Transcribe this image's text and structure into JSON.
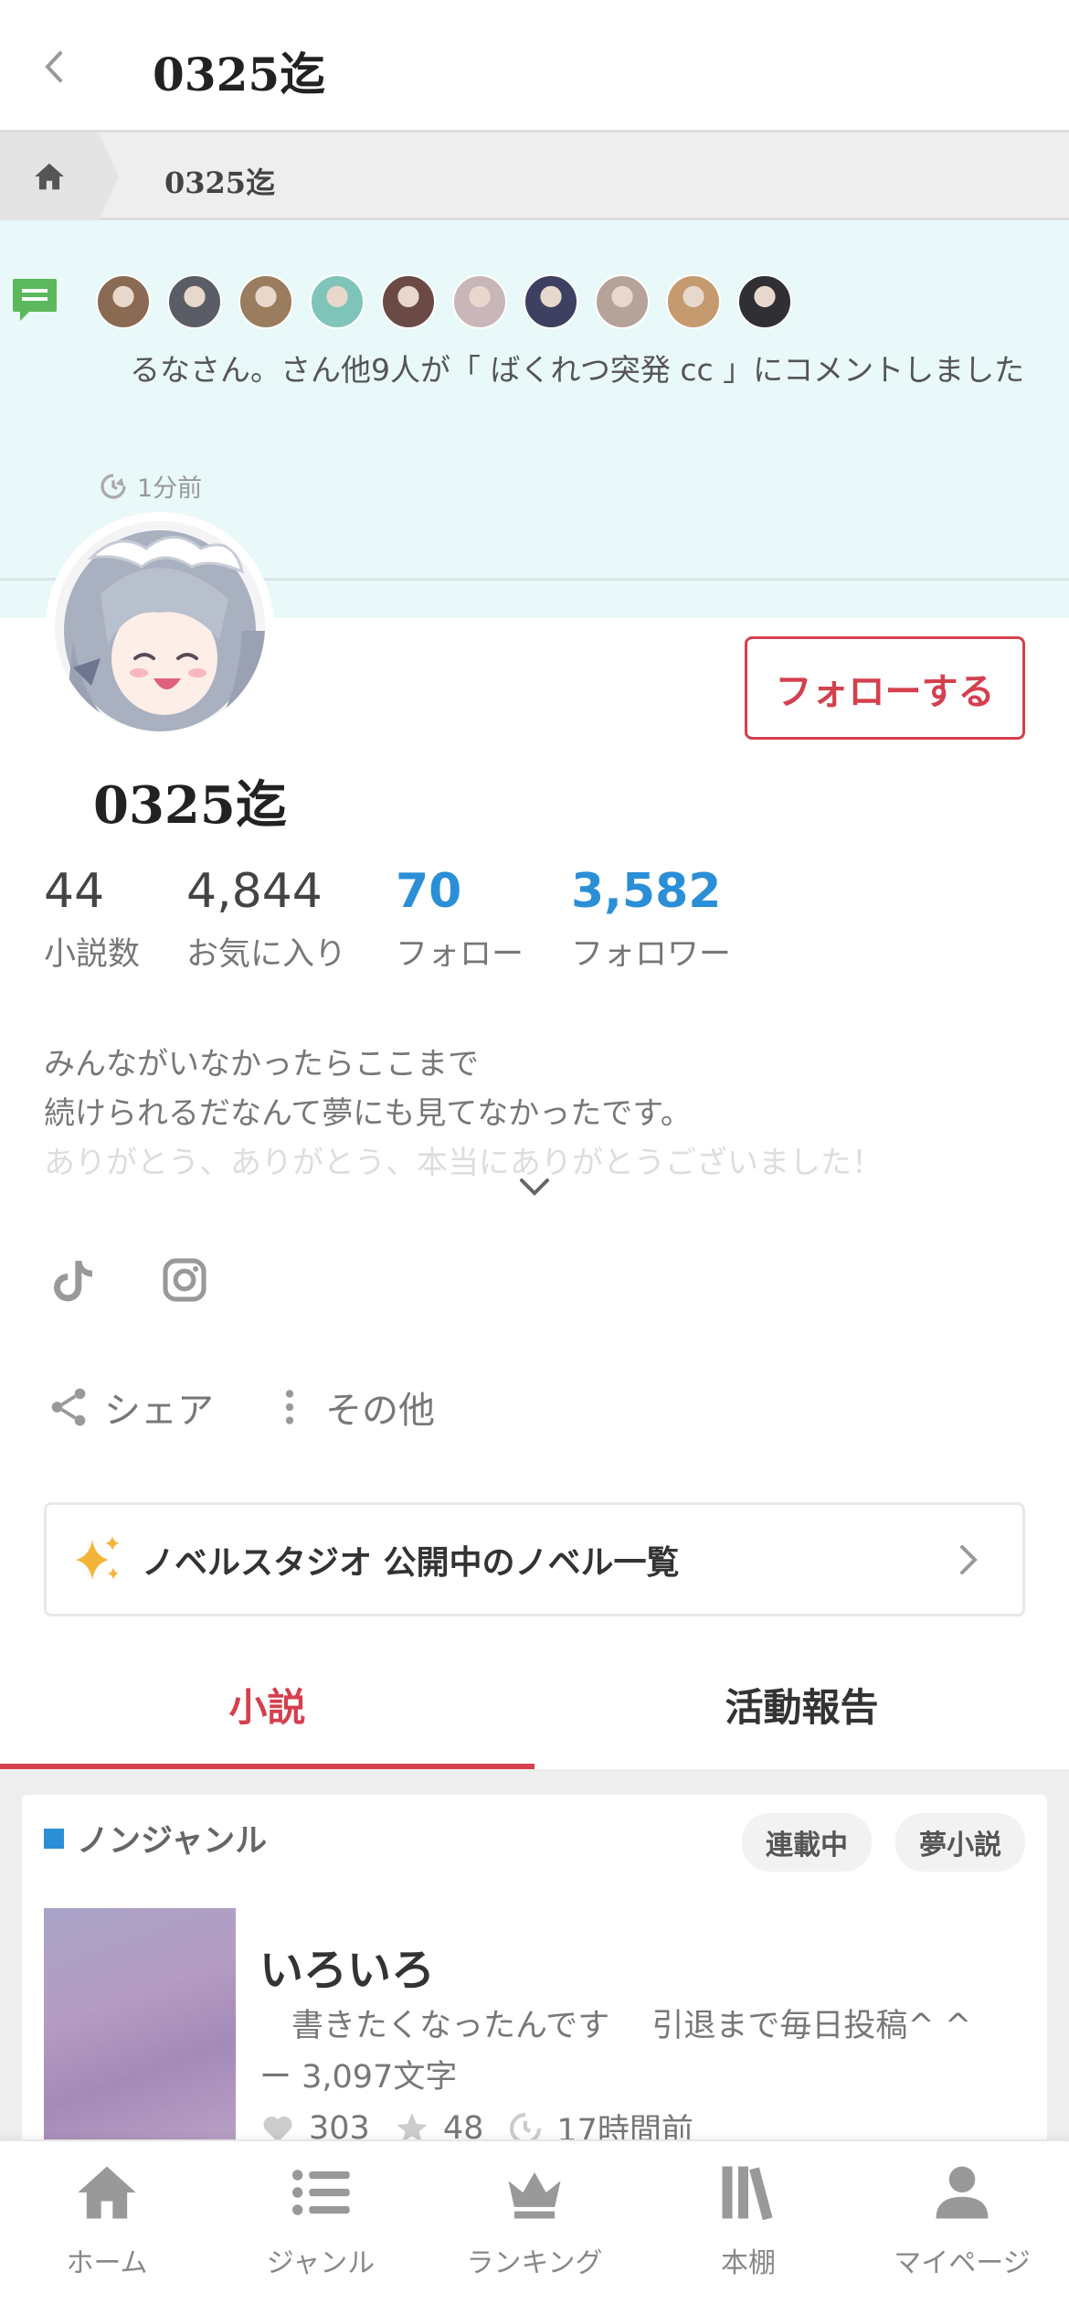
{
  "header": {
    "title": "0325迄"
  },
  "breadcrumb": {
    "current": "0325迄"
  },
  "activity": {
    "text": "るなさん。さん他9人が「 ばくれつ突発 cc 」にコメントしました",
    "time": "1分前",
    "avatar_colors": [
      "#8a6a52",
      "#5b5d66",
      "#9a7c5e",
      "#7fc4b8",
      "#6b4a46",
      "#c9b6b9",
      "#3d4060",
      "#b5a39a",
      "#c49a6e",
      "#2f2f34"
    ]
  },
  "profile": {
    "name": "0325迄",
    "follow_label": "フォローする",
    "stats": [
      {
        "value": "44",
        "label": "小説数",
        "highlight": false
      },
      {
        "value": "4,844",
        "label": "お気に入り",
        "highlight": false
      },
      {
        "value": "70",
        "label": "フォロー",
        "highlight": true
      },
      {
        "value": "3,582",
        "label": "フォロワー",
        "highlight": true
      }
    ],
    "bio": [
      "みんながいなかったらここまで",
      "続けられるだなんて夢にも見てなかったです。",
      "ありがとう、ありがとう、本当にありがとうございました！"
    ]
  },
  "social": {
    "icons": [
      "tiktok-icon",
      "instagram-icon"
    ]
  },
  "actions": {
    "share_label": "シェア",
    "more_label": "その他"
  },
  "novel_studio": {
    "label": "ノベルスタジオ 公開中のノベル一覧"
  },
  "tabs": [
    {
      "label": "小説",
      "active": true
    },
    {
      "label": "活動報告",
      "active": false
    }
  ],
  "novel": {
    "genre": "ノンジャンル",
    "badges": [
      "連載中",
      "夢小説"
    ],
    "title": "いろいろ",
    "description": "　書きたくなったんです　 引退まで毎日投稿^ ^",
    "length": "ー 3,097文字",
    "likes": "303",
    "stars": "48",
    "updated": "17時間前"
  },
  "bottom_nav": [
    {
      "label": "ホーム",
      "icon": "home-icon"
    },
    {
      "label": "ジャンル",
      "icon": "list-icon"
    },
    {
      "label": "ランキング",
      "icon": "crown-icon"
    },
    {
      "label": "本棚",
      "icon": "bookshelf-icon"
    },
    {
      "label": "マイページ",
      "icon": "user-icon"
    }
  ],
  "colors": {
    "accent": "#d4404e",
    "link_blue": "#2a8fd6",
    "banner_bg": "#e9f8f8"
  }
}
